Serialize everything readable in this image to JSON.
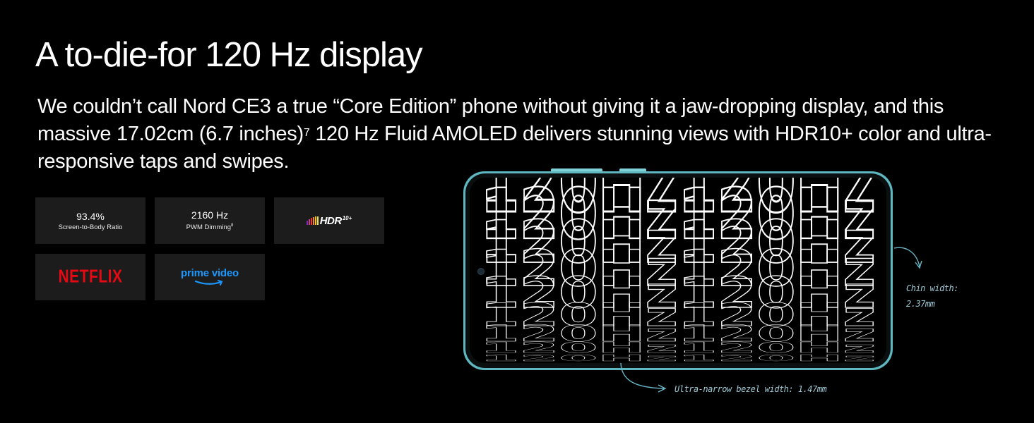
{
  "headline": "A to-die-for 120 Hz display",
  "body": {
    "text_1": "We couldn’t call Nord CE3 a true “Core Edition” phone without giving it a jaw-dropping display, and this massive 17.02cm (6.7 inches)",
    "footnote": "7",
    "text_2": " 120 Hz Fluid AMOLED delivers stunning views with HDR10+ color and ultra-responsive taps and swipes."
  },
  "features": {
    "screen_ratio": {
      "value": "93.4%",
      "label": "Screen-to-Body Ratio"
    },
    "pwm": {
      "value": "2160 Hz",
      "label": "PWM Dimming",
      "footnote": "8"
    },
    "hdr": {
      "logo_text": "HDR",
      "logo_sub": "10+",
      "icon": "hdr10plus-logo"
    },
    "netflix": {
      "logo_text": "NETFLIX",
      "icon": "netflix-logo"
    },
    "prime": {
      "logo_text": "prime video",
      "icon": "prime-video-logo"
    }
  },
  "phone": {
    "screen_text": "120Hz120Hz",
    "accent_color": "#7fd3d8"
  },
  "annotations": {
    "chin_line1": "Chin width:",
    "chin_line2": "2.37mm",
    "bezel": "Ultra-narrow bezel width: 1.47mm"
  },
  "colors": {
    "background": "#000000",
    "card": "#1c1c1c",
    "netflix_red": "#e50914",
    "prime_blue": "#1a98ff",
    "annotation": "#9ec9d6"
  }
}
